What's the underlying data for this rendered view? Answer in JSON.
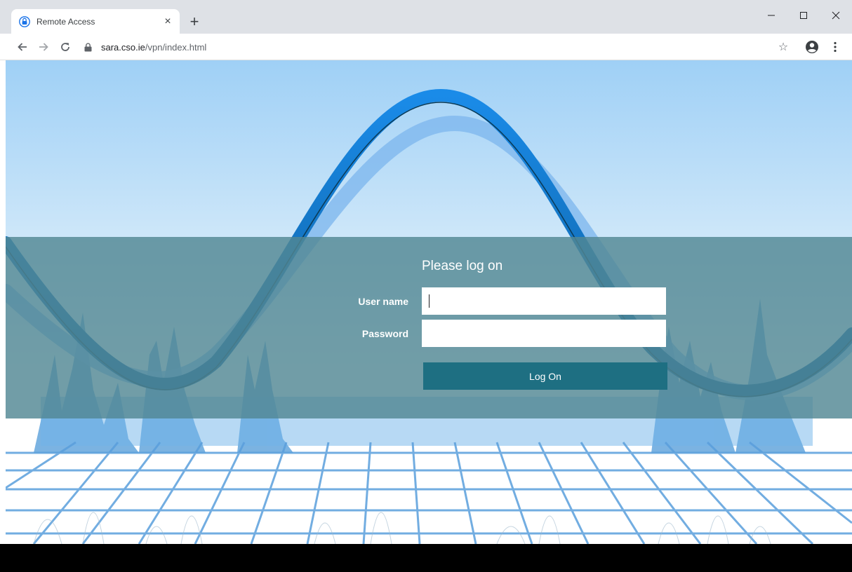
{
  "browser": {
    "tab_title": "Remote Access",
    "tab_close_glyph": "×",
    "new_tab_glyph": "+",
    "url_host": "sara.cso.ie",
    "url_path": "/vpn/index.html",
    "star_glyph": "☆",
    "icons": {
      "favicon": "remote-access-lock-icon",
      "back": "arrow-left-icon",
      "forward": "arrow-right-icon",
      "reload": "reload-icon",
      "lock": "lock-icon",
      "bookmark": "star-icon",
      "account": "account-circle-icon",
      "menu": "kebab-menu-icon"
    }
  },
  "login": {
    "title": "Please log on",
    "username_label": "User name",
    "password_label": "Password",
    "username_value": "",
    "password_value": "",
    "submit_label": "Log On"
  },
  "colors": {
    "band": "#528794",
    "button": "#1e6f82",
    "wave": "#1a8be8",
    "grid": "#5a9fdc"
  }
}
